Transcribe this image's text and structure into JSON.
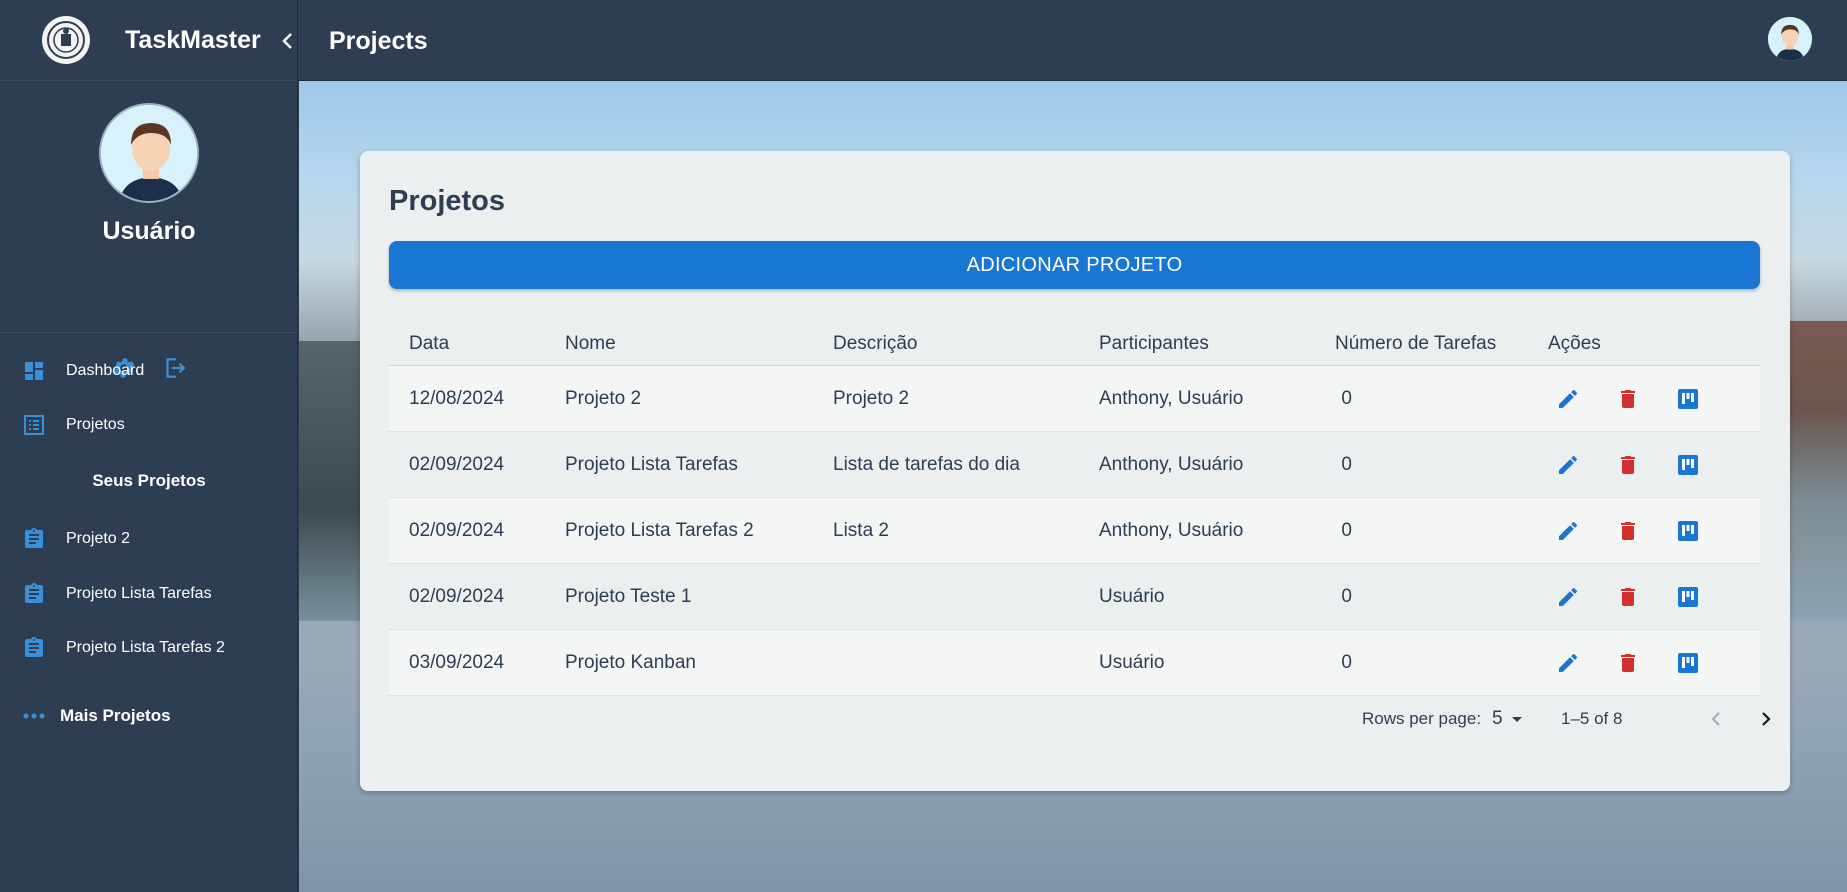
{
  "app": {
    "name": "TaskMaster"
  },
  "header": {
    "title": "Projects"
  },
  "user": {
    "name": "Usuário"
  },
  "nav": {
    "dashboard": "Dashboard",
    "projects": "Projetos",
    "your_projects_title": "Seus Projetos",
    "your_projects": [
      "Projeto 2",
      "Projeto Lista Tarefas",
      "Projeto Lista Tarefas 2"
    ],
    "more": "Mais Projetos"
  },
  "main": {
    "title": "Projetos",
    "add_button": "ADICIONAR PROJETO",
    "columns": [
      "Data",
      "Nome",
      "Descrição",
      "Participantes",
      "Número de Tarefas",
      "Ações"
    ],
    "rows": [
      [
        "12/08/2024",
        "Projeto 2",
        "Projeto 2",
        "Anthony, Usuário",
        "0"
      ],
      [
        "02/09/2024",
        "Projeto Lista Tarefas",
        "Lista de tarefas do dia",
        "Anthony, Usuário",
        "0"
      ],
      [
        "02/09/2024",
        "Projeto Lista Tarefas 2",
        "Lista 2",
        "Anthony, Usuário",
        "0"
      ],
      [
        "02/09/2024",
        "Projeto Teste 1",
        "",
        "Usuário",
        "0"
      ],
      [
        "03/09/2024",
        "Projeto Kanban",
        "",
        "Usuário",
        "0"
      ]
    ],
    "pagination": {
      "rows_label": "Rows per page:",
      "rows_value": "5",
      "range": "1–5 of 8"
    }
  },
  "colors": {
    "sidebar": "#2d3e52",
    "accent": "#1976d2",
    "delete": "#d32f2f",
    "icon_blue": "#3a8fd9"
  },
  "icons": [
    "logo-icon",
    "chevron-left-icon",
    "gear-icon",
    "logout-icon",
    "dashboard-icon",
    "list-icon",
    "clipboard-icon",
    "more-icon",
    "edit-icon",
    "delete-icon",
    "kanban-icon",
    "caret-down-icon",
    "chevron-right-icon"
  ]
}
